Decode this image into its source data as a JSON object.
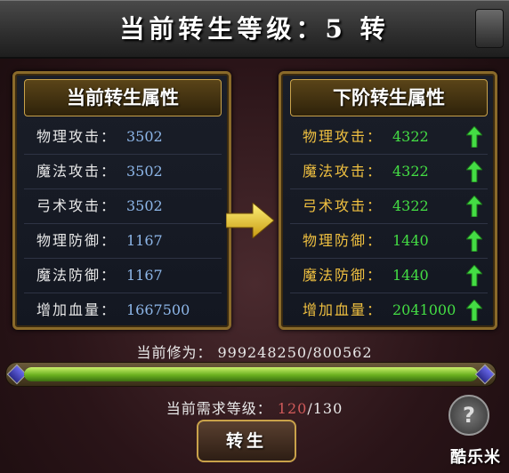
{
  "title": "当前转生等级：5 转",
  "current_panel": {
    "heading": "当前转生属性",
    "rows": [
      {
        "label": "物理攻击：",
        "value": "3502"
      },
      {
        "label": "魔法攻击：",
        "value": "3502"
      },
      {
        "label": "弓术攻击：",
        "value": "3502"
      },
      {
        "label": "物理防御：",
        "value": "1167"
      },
      {
        "label": "魔法防御：",
        "value": "1167"
      },
      {
        "label": "增加血量：",
        "value": "1667500"
      }
    ]
  },
  "next_panel": {
    "heading": "下阶转生属性",
    "rows": [
      {
        "label": "物理攻击：",
        "value": "4322"
      },
      {
        "label": "魔法攻击：",
        "value": "4322"
      },
      {
        "label": "弓术攻击：",
        "value": "4322"
      },
      {
        "label": "物理防御：",
        "value": "1440"
      },
      {
        "label": "魔法防御：",
        "value": "1440"
      },
      {
        "label": "增加血量：",
        "value": "2041000"
      }
    ]
  },
  "cultivation": {
    "label": "当前修为：",
    "value": "999248250/800562",
    "progress": 1.0
  },
  "required_level": {
    "label": "当前需求等级：",
    "current": "120",
    "sep": "/",
    "target": "130"
  },
  "rebirth_button": "转生",
  "help_glyph": "?",
  "watermark": "酷乐米",
  "colors": {
    "stat_current": "#8db6e8",
    "stat_next": "#44dd44",
    "label_next": "#f0c040",
    "level_red": "#d05a5a"
  }
}
